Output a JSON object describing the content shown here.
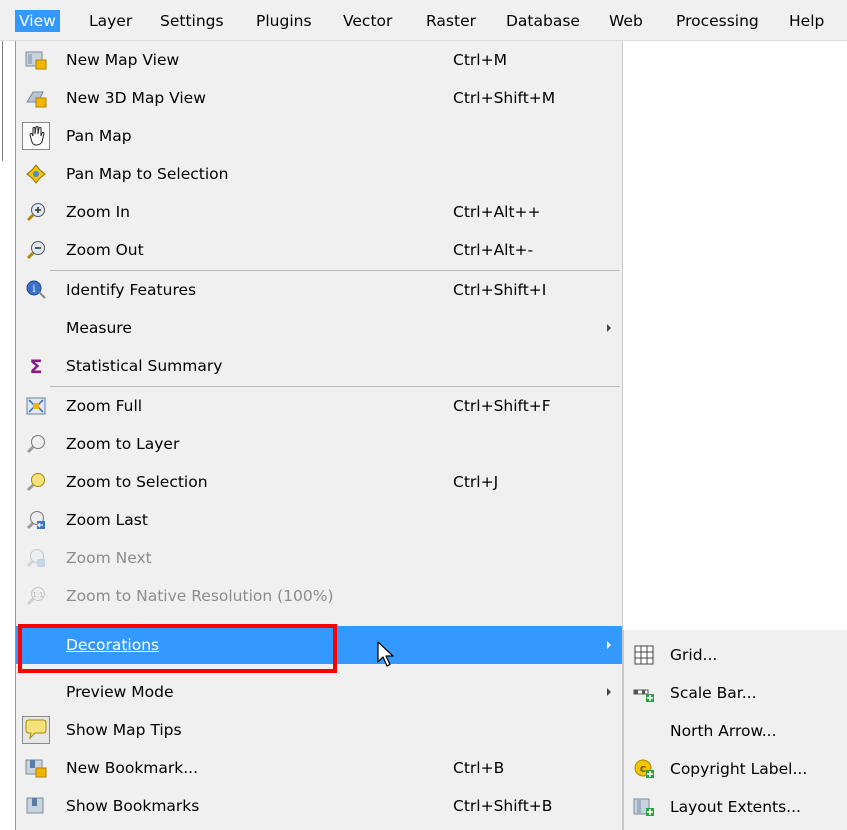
{
  "menubar": {
    "items": [
      {
        "label": "View"
      },
      {
        "label": "Layer"
      },
      {
        "label": "Settings"
      },
      {
        "label": "Plugins"
      },
      {
        "label": "Vector"
      },
      {
        "label": "Raster"
      },
      {
        "label": "Database"
      },
      {
        "label": "Web"
      },
      {
        "label": "Processing"
      },
      {
        "label": "Help"
      }
    ]
  },
  "view_menu": {
    "items": [
      {
        "label": "New Map View",
        "shortcut": "Ctrl+M",
        "icon": "new-map-view-icon"
      },
      {
        "label": "New 3D Map View",
        "shortcut": "Ctrl+Shift+M",
        "icon": "new-3d-map-view-icon"
      },
      {
        "label": "Pan Map",
        "shortcut": "",
        "icon": "hand-pan-icon"
      },
      {
        "label": "Pan Map to Selection",
        "shortcut": "",
        "icon": "pan-to-selection-icon"
      },
      {
        "label": "Zoom In",
        "shortcut": "Ctrl+Alt++",
        "icon": "zoom-in-icon"
      },
      {
        "label": "Zoom Out",
        "shortcut": "Ctrl+Alt+-",
        "icon": "zoom-out-icon"
      },
      {
        "label": "Identify Features",
        "shortcut": "Ctrl+Shift+I",
        "icon": "identify-icon"
      },
      {
        "label": "Measure",
        "shortcut": "",
        "icon": ""
      },
      {
        "label": "Statistical Summary",
        "shortcut": "",
        "icon": "sigma-icon"
      },
      {
        "label": "Zoom Full",
        "shortcut": "Ctrl+Shift+F",
        "icon": "zoom-full-icon"
      },
      {
        "label": "Zoom to Layer",
        "shortcut": "",
        "icon": "zoom-to-layer-icon"
      },
      {
        "label": "Zoom to Selection",
        "shortcut": "Ctrl+J",
        "icon": "zoom-to-selection-icon"
      },
      {
        "label": "Zoom Last",
        "shortcut": "",
        "icon": "zoom-last-icon"
      },
      {
        "label": "Zoom Next",
        "shortcut": "",
        "icon": "zoom-next-icon"
      },
      {
        "label": "Zoom to Native Resolution (100%)",
        "shortcut": "",
        "icon": "zoom-native-icon"
      },
      {
        "label": "Decorations",
        "shortcut": "",
        "icon": ""
      },
      {
        "label": "Preview Mode",
        "shortcut": "",
        "icon": ""
      },
      {
        "label": "Show Map Tips",
        "shortcut": "",
        "icon": "map-tips-icon"
      },
      {
        "label": "New Bookmark...",
        "shortcut": "Ctrl+B",
        "icon": "new-bookmark-icon"
      },
      {
        "label": "Show Bookmarks",
        "shortcut": "Ctrl+Shift+B",
        "icon": "show-bookmarks-icon"
      }
    ]
  },
  "decorations_submenu": {
    "items": [
      {
        "label": "Grid...",
        "icon": "grid-icon"
      },
      {
        "label": "Scale Bar...",
        "icon": "scale-bar-icon"
      },
      {
        "label": "North Arrow...",
        "icon": ""
      },
      {
        "label": "Copyright Label...",
        "icon": "copyright-label-icon"
      },
      {
        "label": "Layout Extents...",
        "icon": "layout-extents-icon"
      }
    ]
  },
  "colors": {
    "highlight": "#3399ff",
    "menu_bg": "#f0f0f0",
    "annotation_box": "#ff0000"
  }
}
